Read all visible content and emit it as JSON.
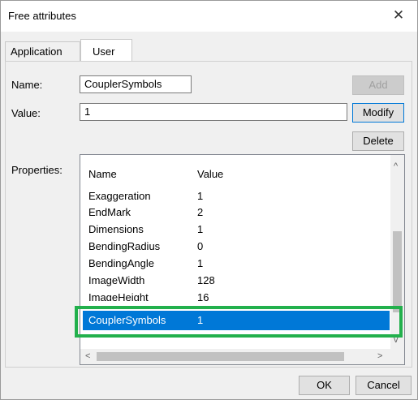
{
  "window": {
    "title": "Free attributes",
    "close_glyph": "✕"
  },
  "tabs": [
    {
      "label": "Application",
      "active": false
    },
    {
      "label": "User",
      "active": true
    }
  ],
  "form": {
    "name_label": "Name:",
    "name_value": "CouplerSymbols",
    "value_label": "Value:",
    "value_value": "1",
    "properties_label": "Properties:"
  },
  "buttons": {
    "add": "Add",
    "modify": "Modify",
    "delete": "Delete",
    "ok": "OK",
    "cancel": "Cancel"
  },
  "properties": {
    "columns": [
      "Name",
      "Value"
    ],
    "rows": [
      {
        "name": "Exaggeration",
        "value": "1"
      },
      {
        "name": "EndMark",
        "value": "2"
      },
      {
        "name": "Dimensions",
        "value": "1"
      },
      {
        "name": "BendingRadius",
        "value": "0"
      },
      {
        "name": "BendingAngle",
        "value": "1"
      },
      {
        "name": "ImageWidth",
        "value": "128"
      },
      {
        "name": "ImageHeight",
        "value": "16"
      },
      {
        "name": "CouplerSymbols",
        "value": "1",
        "selected": true
      }
    ]
  },
  "scroll_arrows": {
    "up": "^",
    "down": "v",
    "left": "<",
    "right": ">"
  },
  "colors": {
    "selection": "#0078d7",
    "highlight_box": "#22b04c"
  }
}
